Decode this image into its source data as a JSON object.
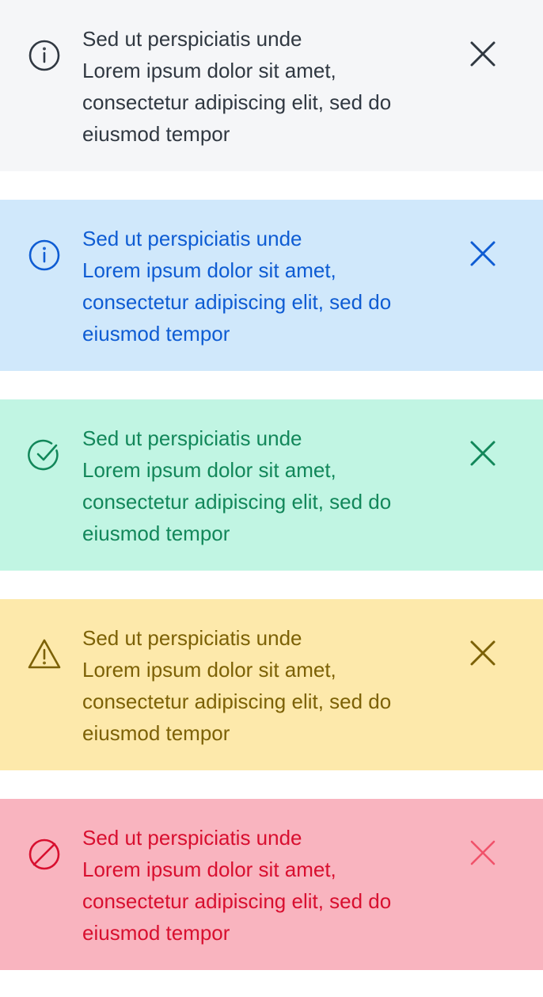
{
  "alerts": [
    {
      "variant": "neutral",
      "icon": "info-icon",
      "title": "Sed ut perspiciatis unde",
      "line1": "Lorem ipsum dolor sit amet,",
      "line2": "consectetur adipiscing elit, sed do",
      "line3": "eiusmod tempor",
      "background": "#f5f6f8",
      "color": "#303841"
    },
    {
      "variant": "info",
      "icon": "info-icon",
      "title": "Sed ut perspiciatis unde",
      "line1": "Lorem ipsum dolor sit amet,",
      "line2": "consectetur adipiscing elit, sed do",
      "line3": "eiusmod tempor",
      "background": "#d0e8fb",
      "color": "#0e5cd3"
    },
    {
      "variant": "success",
      "icon": "check-circle-icon",
      "title": "Sed ut perspiciatis unde",
      "line1": "Lorem ipsum dolor sit amet,",
      "line2": "consectetur adipiscing elit, sed do",
      "line3": "eiusmod tempor",
      "background": "#c1f5e3",
      "color": "#12875a"
    },
    {
      "variant": "warning",
      "icon": "warning-triangle-icon",
      "title": "Sed ut perspiciatis unde",
      "line1": "Lorem ipsum dolor sit amet,",
      "line2": "consectetur adipiscing elit, sed do",
      "line3": "eiusmod tempor",
      "background": "#fde9ab",
      "color": "#7c6106"
    },
    {
      "variant": "danger",
      "icon": "blocked-icon",
      "title": "Sed ut perspiciatis unde",
      "line1": "Lorem ipsum dolor sit amet,",
      "line2": "consectetur adipiscing elit, sed do",
      "line3": "eiusmod tempor",
      "background": "#f9b4bf",
      "color": "#d80f2f"
    }
  ]
}
